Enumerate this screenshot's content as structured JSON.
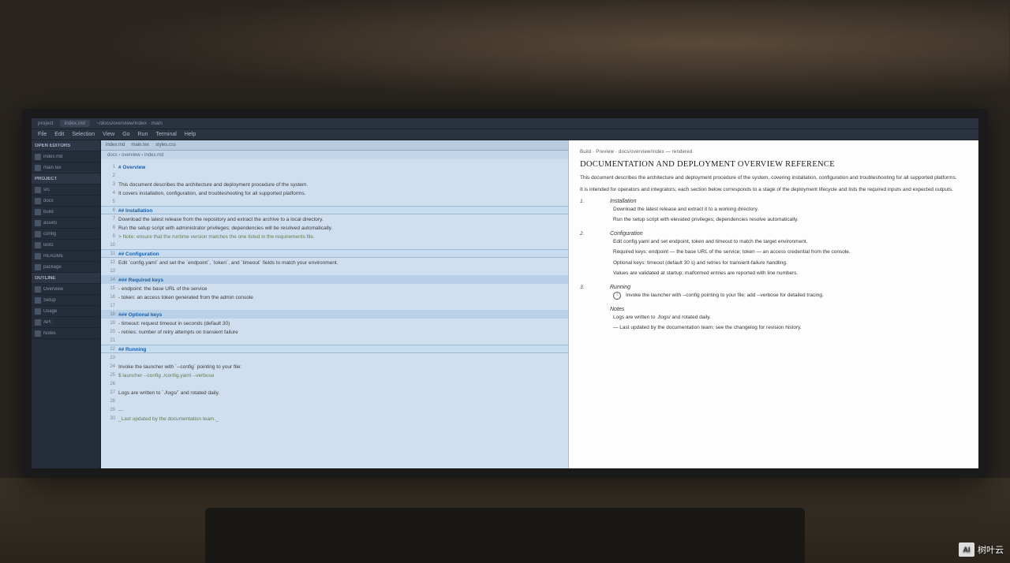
{
  "titlebar": {
    "app": "project",
    "tab": "index.md",
    "path": "~/docs/overview/index · main"
  },
  "menubar": [
    "File",
    "Edit",
    "Selection",
    "View",
    "Go",
    "Run",
    "Terminal",
    "Help"
  ],
  "sidebar": {
    "groups": [
      {
        "label": "OPEN EDITORS",
        "items": [
          "index.md",
          "main.tex"
        ]
      },
      {
        "label": "PROJECT",
        "items": [
          "src",
          "docs",
          "build",
          "assets",
          "config",
          "tests",
          "README",
          "package"
        ]
      },
      {
        "label": "OUTLINE",
        "items": [
          "Overview",
          "Setup",
          "Usage",
          "API",
          "Notes"
        ]
      }
    ]
  },
  "editor": {
    "tabs": [
      "index.md",
      "main.tex",
      "styles.css"
    ],
    "crumb": "docs › overview › index.md",
    "lines": [
      {
        "n": "1",
        "t": "# Overview",
        "cls": "kw"
      },
      {
        "n": "2",
        "t": "",
        "cls": ""
      },
      {
        "n": "3",
        "t": "This document describes the architecture and deployment procedure of the system.",
        "cls": "vn"
      },
      {
        "n": "4",
        "t": "It covers installation, configuration, and troubleshooting for all supported platforms.",
        "cls": "vn"
      },
      {
        "n": "5",
        "t": "",
        "cls": ""
      },
      {
        "n": "6",
        "t": "## Installation",
        "cls": "kw",
        "sec": true
      },
      {
        "n": "7",
        "t": "Download the latest release from the repository and extract the archive to a local directory.",
        "cls": "vn"
      },
      {
        "n": "8",
        "t": "Run the setup script with administrator privileges; dependencies will be resolved automatically.",
        "cls": "vn"
      },
      {
        "n": "9",
        "t": "> Note: ensure that the runtime version matches the one listed in the requirements file.",
        "cls": "cm"
      },
      {
        "n": "10",
        "t": "",
        "cls": ""
      },
      {
        "n": "11",
        "t": "## Configuration",
        "cls": "kw",
        "sec": true
      },
      {
        "n": "12",
        "t": "Edit `config.yaml` and set the `endpoint`, `token`, and `timeout` fields to match your environment.",
        "cls": "vn"
      },
      {
        "n": "13",
        "t": "",
        "cls": ""
      },
      {
        "n": "14",
        "t": "### Required keys",
        "cls": "kw",
        "hl": true
      },
      {
        "n": "15",
        "t": "- endpoint: the base URL of the service",
        "cls": "vn"
      },
      {
        "n": "16",
        "t": "- token: an access token generated from the admin console",
        "cls": "vn"
      },
      {
        "n": "17",
        "t": "",
        "cls": ""
      },
      {
        "n": "18",
        "t": "### Optional keys",
        "cls": "kw",
        "hl": true
      },
      {
        "n": "19",
        "t": "- timeout: request timeout in seconds (default 30)",
        "cls": "vn"
      },
      {
        "n": "20",
        "t": "- retries: number of retry attempts on transient failure",
        "cls": "vn"
      },
      {
        "n": "21",
        "t": "",
        "cls": ""
      },
      {
        "n": "22",
        "t": "## Running",
        "cls": "kw",
        "sec": true
      },
      {
        "n": "23",
        "t": "",
        "cls": ""
      },
      {
        "n": "24",
        "t": "Invoke the launcher with `--config` pointing to your file:",
        "cls": "vn"
      },
      {
        "n": "25",
        "t": "    $ launcher --config ./config.yaml --verbose",
        "cls": "cm"
      },
      {
        "n": "26",
        "t": "",
        "cls": ""
      },
      {
        "n": "27",
        "t": "Logs are written to `./logs/` and rotated daily.",
        "cls": "vn"
      },
      {
        "n": "28",
        "t": "",
        "cls": ""
      },
      {
        "n": "29",
        "t": "---",
        "cls": "cm"
      },
      {
        "n": "30",
        "t": "_Last updated by the documentation team._",
        "cls": "cm"
      }
    ]
  },
  "preview": {
    "toprow": "Build · Preview · docs/overview/index — rendered",
    "title": "DOCUMENTATION AND DEPLOYMENT OVERVIEW REFERENCE",
    "intro1": "This document describes the architecture and deployment procedure of the system, covering installation, configuration and troubleshooting for all supported platforms.",
    "intro2": "It is intended for operators and integrators; each section below corresponds to a stage of the deployment lifecycle and lists the required inputs and expected outputs.",
    "sections": [
      {
        "num": "1.",
        "sub": "Installation",
        "lines": [
          "Download the latest release and extract it to a working directory.",
          "Run the setup script with elevated privileges; dependencies resolve automatically."
        ]
      },
      {
        "num": "2.",
        "sub": "Configuration",
        "lines": [
          "Edit config.yaml and set endpoint, token and timeout to match the target environment.",
          "Required keys: endpoint — the base URL of the service; token — an access credential from the console.",
          "Optional keys: timeout (default 30 s) and retries for transient-failure handling.",
          "Values are validated at startup; malformed entries are reported with line numbers."
        ]
      },
      {
        "num": "3.",
        "sub": "Running",
        "lines": [
          "Invoke the launcher with --config pointing to your file; add --verbose for detailed tracing."
        ],
        "icon": true
      },
      {
        "num": "",
        "sub": "Notes",
        "lines": [
          "Logs are written to ./logs/ and rotated daily.",
          "— Last updated by the documentation team; see the changelog for revision history."
        ]
      }
    ]
  },
  "watermark": "树叶云"
}
